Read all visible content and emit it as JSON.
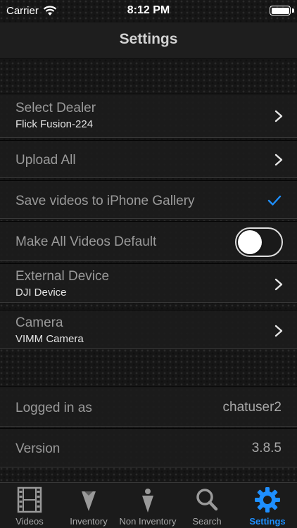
{
  "status_bar": {
    "carrier": "Carrier",
    "time": "8:12 PM"
  },
  "nav": {
    "title": "Settings"
  },
  "settings": {
    "dealer": {
      "title": "Select Dealer",
      "value": "Flick Fusion-224"
    },
    "upload_all": {
      "title": "Upload All"
    },
    "save_gallery": {
      "title": "Save videos to iPhone Gallery",
      "checked": true
    },
    "default_videos": {
      "title": "Make All Videos Default",
      "toggle_on": false
    },
    "external_device": {
      "title": "External Device",
      "value": "DJI Device"
    },
    "camera": {
      "title": "Camera",
      "value": "VIMM Camera"
    }
  },
  "account": {
    "logged_in": {
      "label": "Logged in as",
      "value": "chatuser2"
    },
    "version": {
      "label": "Version",
      "value": "3.8.5"
    }
  },
  "tabs": [
    {
      "label": "Videos",
      "icon": "film-strip-icon",
      "active": false
    },
    {
      "label": "Inventory",
      "icon": "funnel-icon",
      "active": false
    },
    {
      "label": "Non Inventory",
      "icon": "person-pin-icon",
      "active": false
    },
    {
      "label": "Search",
      "icon": "magnifier-icon",
      "active": false
    },
    {
      "label": "Settings",
      "icon": "gear-icon",
      "active": true
    }
  ],
  "colors": {
    "accent": "#1e8fff",
    "background": "#161616",
    "cell": "#1c1c1c"
  }
}
